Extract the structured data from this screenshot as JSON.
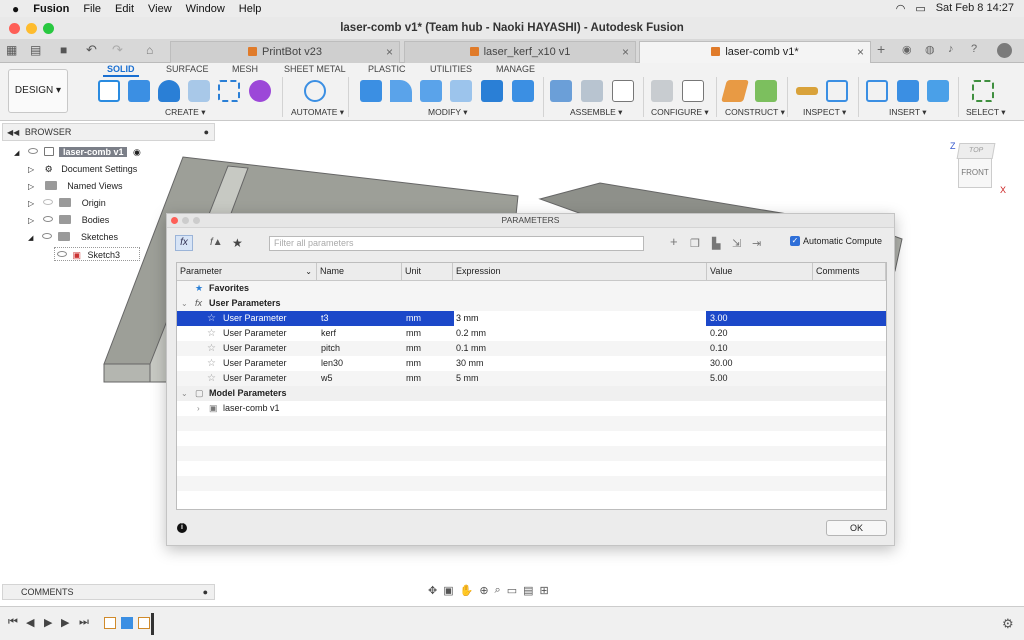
{
  "menubar": {
    "app": "Fusion",
    "items": [
      "File",
      "Edit",
      "View",
      "Window",
      "Help"
    ],
    "clock": "Sat Feb 8  14:27"
  },
  "window": {
    "title": "laser-comb v1* (Team hub - Naoki HAYASHI) - Autodesk Fusion"
  },
  "tabs": [
    {
      "label": "PrintBot v23"
    },
    {
      "label": "laser_kerf_x10 v1"
    },
    {
      "label": "laser-comb v1*"
    }
  ],
  "ribbon": {
    "workspace": "DESIGN",
    "tabs": [
      "SOLID",
      "SURFACE",
      "MESH",
      "SHEET METAL",
      "PLASTIC",
      "UTILITIES",
      "MANAGE"
    ],
    "groups": [
      "CREATE ▾",
      "AUTOMATE ▾",
      "MODIFY ▾",
      "ASSEMBLE ▾",
      "CONFIGURE ▾",
      "CONSTRUCT ▾",
      "INSPECT ▾",
      "INSERT ▾",
      "SELECT ▾"
    ]
  },
  "browser": {
    "title": "BROWSER",
    "root": "laser-comb v1",
    "items": [
      "Document Settings",
      "Named Views",
      "Origin",
      "Bodies",
      "Sketches",
      "Sketch3"
    ]
  },
  "viewcube": {
    "front": "FRONT",
    "top": "TOP",
    "z": "Z",
    "x": "X"
  },
  "dialog": {
    "title": "PARAMETERS",
    "filter_placeholder": "Filter all parameters",
    "auto_compute": "Automatic Compute",
    "columns": [
      "Parameter",
      "Name",
      "Unit",
      "Expression",
      "Value",
      "Comments"
    ],
    "favorites": "Favorites",
    "user_params": "User Parameters",
    "rows": [
      {
        "param": "User Parameter",
        "name": "t3",
        "unit": "mm",
        "expr": "3 mm",
        "value": "3.00"
      },
      {
        "param": "User Parameter",
        "name": "kerf",
        "unit": "mm",
        "expr": "0.2 mm",
        "value": "0.20"
      },
      {
        "param": "User Parameter",
        "name": "pitch",
        "unit": "mm",
        "expr": "0.1 mm",
        "value": "0.10"
      },
      {
        "param": "User Parameter",
        "name": "len30",
        "unit": "mm",
        "expr": "30 mm",
        "value": "30.00"
      },
      {
        "param": "User Parameter",
        "name": "w5",
        "unit": "mm",
        "expr": "5 mm",
        "value": "5.00"
      }
    ],
    "model_params": "Model Parameters",
    "model_item": "laser-comb v1",
    "ok": "OK"
  },
  "bottom": {
    "comments": "COMMENTS"
  }
}
